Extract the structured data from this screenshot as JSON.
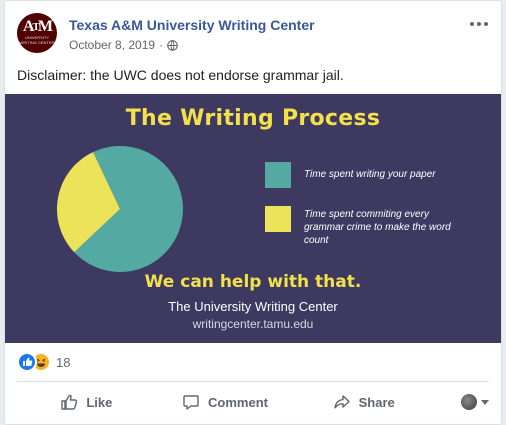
{
  "post": {
    "page_name": "Texas A&M University Writing Center",
    "date": "October 8, 2019",
    "separator": "·",
    "text": "Disclaimer: the UWC does not endorse grammar jail.",
    "avatar_logo": "ATM",
    "avatar_subtext": "UNIVERSITY WRITING CENTER"
  },
  "image": {
    "title": "The Writing Process",
    "legend": [
      {
        "label": "Time spent writing your paper",
        "color": "#55a9a3"
      },
      {
        "label": "Time spent commiting every grammar crime to make the word count",
        "color": "#ede35a"
      }
    ],
    "tagline": "We can help with that.",
    "org": "The University Writing Center",
    "url": "writingcenter.tamu.edu"
  },
  "chart_data": {
    "type": "pie",
    "categories": [
      "Time spent writing your paper",
      "Time spent commiting every grammar crime to make the word count"
    ],
    "values": [
      70,
      30
    ],
    "colors": [
      "#55a9a3",
      "#ede35a"
    ]
  },
  "reactions": {
    "count": "18",
    "types": [
      "like-icon",
      "haha-icon"
    ]
  },
  "actions": {
    "like": "Like",
    "comment": "Comment",
    "share": "Share"
  },
  "colors": {
    "page_name": "#385898",
    "image_bg": "#3e3961",
    "accent_yellow": "#f2e14a"
  }
}
